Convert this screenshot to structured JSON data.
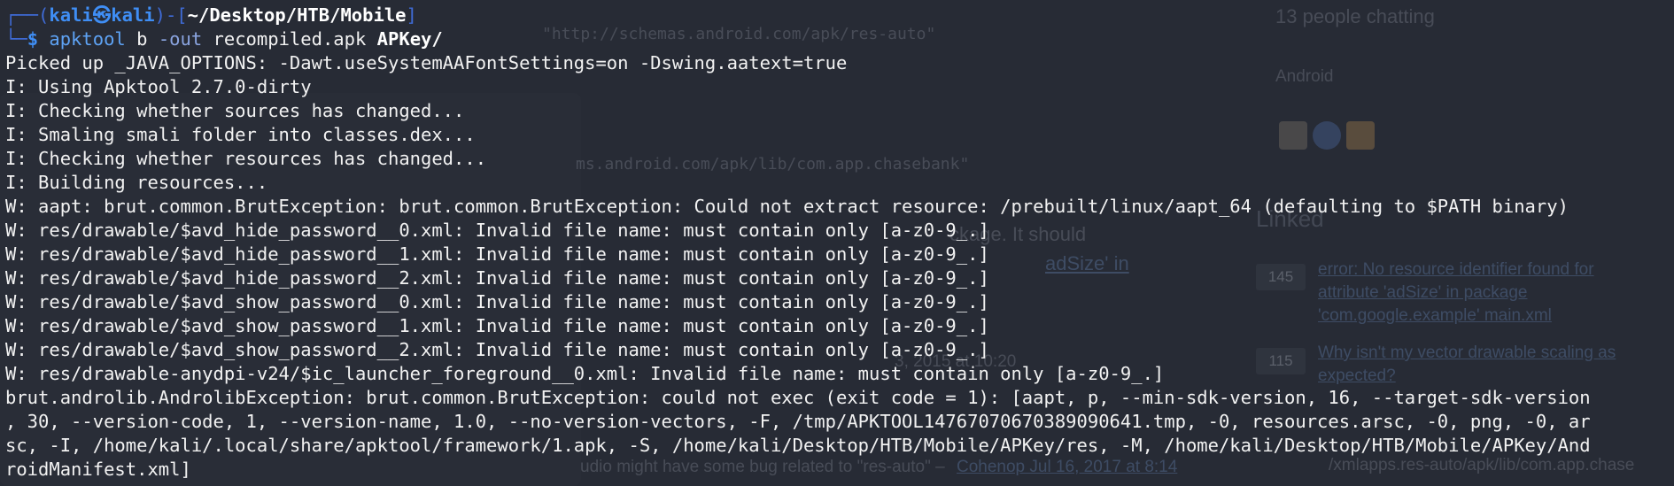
{
  "background_page": {
    "chatting": "13 people chatting",
    "room_name": "Android",
    "schema_url_1": "\"http://schemas.android.com/apk/res-auto\"",
    "schema_url_2": "ms.android.com/apk/lib/com.app.chasebank\"",
    "linked_heading": "Linked",
    "answer_fragment_1": "ckage. It should",
    "answer_fragment_2": "adSize' in",
    "linked_q1_score": "145",
    "linked_q1_l1": "error: No resource identifier found for",
    "linked_q1_l2": "attribute 'adSize' in package",
    "linked_q1_l3": "'com.google.example' main.xml",
    "linked_q2_score": "115",
    "linked_q2_l1": "Why isn't my vector drawable scaling as",
    "linked_q2_l2": "expected?",
    "comment_date": "3, 2015 at 10:20",
    "comment_text": "udio might have some bug related to \"res-auto\" –",
    "comment_user": "Cohenop Jul 16, 2017 at 8:14",
    "right_bottom": "/xmlapps.res-auto/apk/lib/com.app.chase"
  },
  "terminal": {
    "prompt": {
      "frame_top": "┌──(",
      "user": "kali",
      "at": "㉿",
      "host": "kali",
      "sep": ")-[",
      "cwd": "~/Desktop/HTB/Mobile",
      "close": "]",
      "frame_bottom": "└─",
      "dollar": "$ "
    },
    "command": {
      "program": "apktool",
      "subcommand": " b ",
      "flag": "-out",
      "output": " recompiled.apk ",
      "input": "APKey/"
    },
    "output_lines": [
      "Picked up _JAVA_OPTIONS: -Dawt.useSystemAAFontSettings=on -Dswing.aatext=true",
      "I: Using Apktool 2.7.0-dirty",
      "I: Checking whether sources has changed...",
      "I: Smaling smali folder into classes.dex...",
      "I: Checking whether resources has changed...",
      "I: Building resources...",
      "W: aapt: brut.common.BrutException: brut.common.BrutException: Could not extract resource: /prebuilt/linux/aapt_64 (defaulting to $PATH binary)",
      "W: res/drawable/$avd_hide_password__0.xml: Invalid file name: must contain only [a-z0-9_.]",
      "W: res/drawable/$avd_hide_password__1.xml: Invalid file name: must contain only [a-z0-9_.]",
      "W: res/drawable/$avd_hide_password__2.xml: Invalid file name: must contain only [a-z0-9_.]",
      "W: res/drawable/$avd_show_password__0.xml: Invalid file name: must contain only [a-z0-9_.]",
      "W: res/drawable/$avd_show_password__1.xml: Invalid file name: must contain only [a-z0-9_.]",
      "W: res/drawable/$avd_show_password__2.xml: Invalid file name: must contain only [a-z0-9_.]",
      "W: res/drawable-anydpi-v24/$ic_launcher_foreground__0.xml: Invalid file name: must contain only [a-z0-9_.]",
      "brut.androlib.AndrolibException: brut.common.BrutException: could not exec (exit code = 1): [aapt, p, --min-sdk-version, 16, --target-sdk-version",
      ", 30, --version-code, 1, --version-name, 1.0, --no-version-vectors, -F, /tmp/APKTOOL14767070670389090641.tmp, -0, resources.arsc, -0, png, -0, ar",
      "sc, -I, /home/kali/.local/share/apktool/framework/1.apk, -S, /home/kali/Desktop/HTB/Mobile/APKey/res, -M, /home/kali/Desktop/HTB/Mobile/APKey/And",
      "roidManifest.xml]"
    ]
  },
  "colors": {
    "background": "#272b35",
    "prompt_frame": "#3f6bd6",
    "prompt_user": "#3f8ef5",
    "command": "#5ea3f5",
    "text": "#f2f2f2"
  }
}
